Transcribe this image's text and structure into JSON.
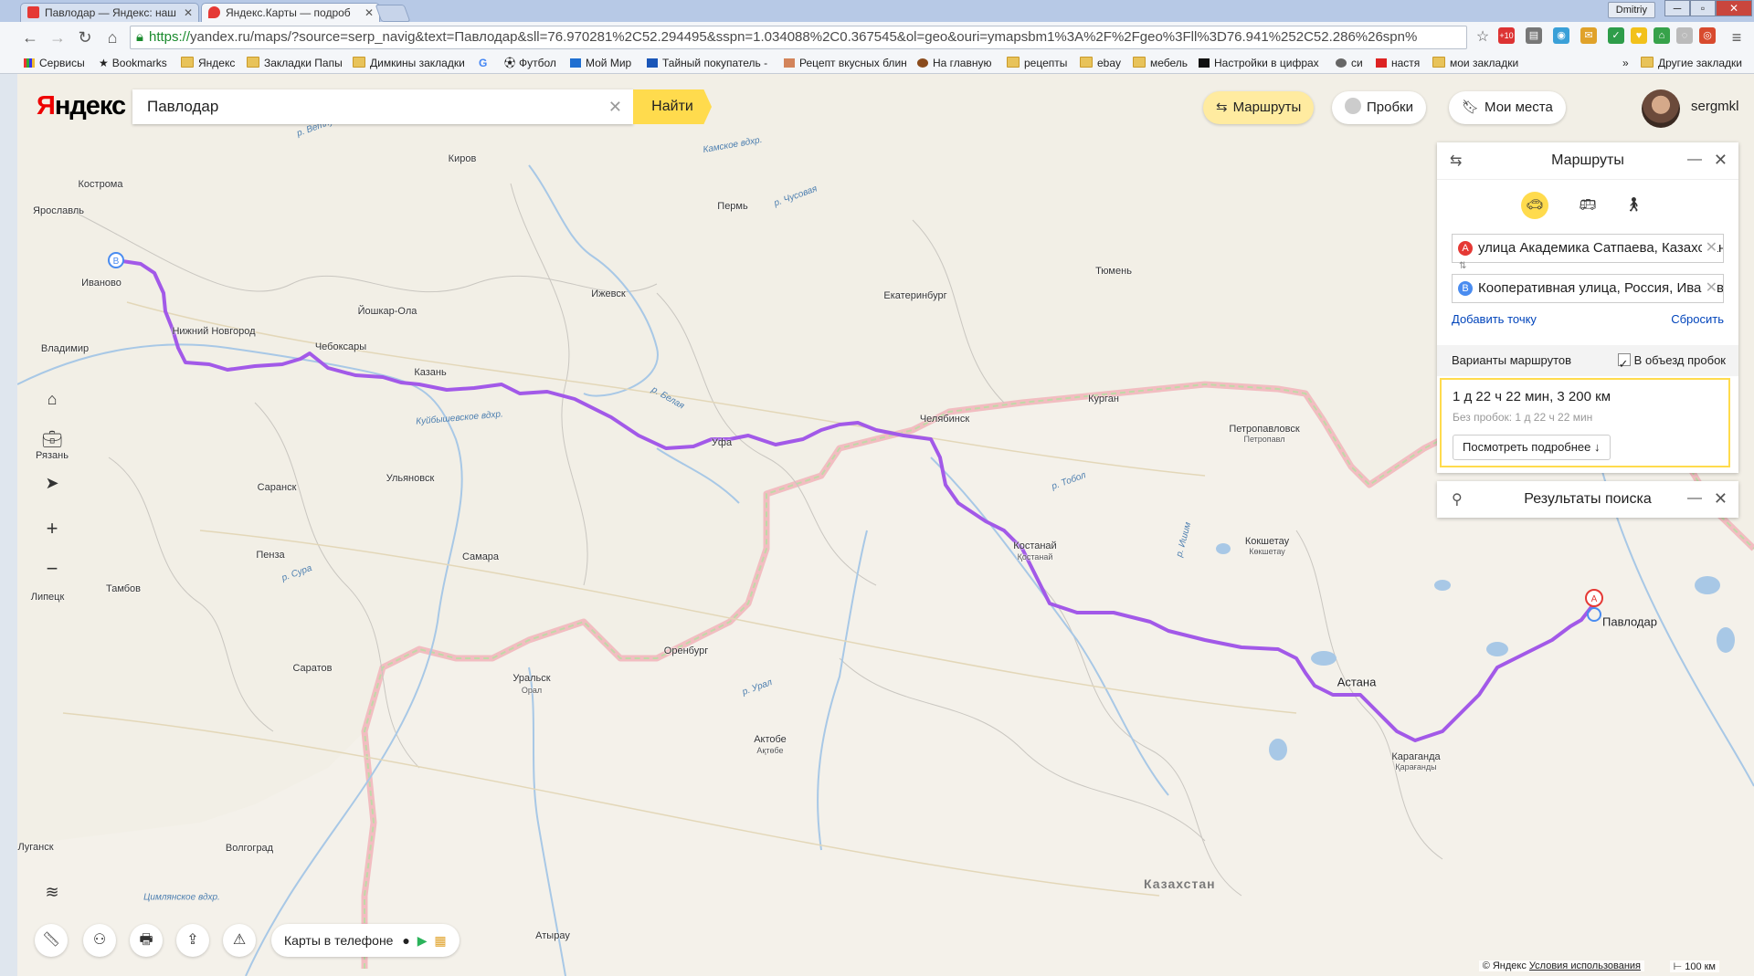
{
  "browser": {
    "tabs": [
      {
        "title": "Павлодар — Яндекс: наш",
        "active": false,
        "favicon_color": "#e53935"
      },
      {
        "title": "Яндекс.Карты — подроб",
        "active": true,
        "favicon_color": "#e53935"
      }
    ],
    "user": "Dmitriy",
    "url_proto": "https://",
    "url_rest": "yandex.ru/maps/?source=serp_navig&text=Павлодар&sll=76.970281%2C52.294495&sspn=1.034088%2C0.367545&ol=geo&ouri=ymapsbm1%3A%2F%2Fgeo%3Fll%3D76.941%252C52.286%26spn%",
    "bookmarks": [
      "Сервисы",
      "Bookmarks",
      "Яндекс",
      "Закладки Папы",
      "Димкины закладки",
      "Футбол",
      "Мой Мир",
      "Тайный покупатель -",
      "Рецепт вкусных блин",
      "На главную",
      "рецепты",
      "ebay",
      "мебель",
      "Настройки в цифрах",
      "си",
      "настя",
      "мои закладки",
      "Другие закладки"
    ],
    "ext_badge": "+10"
  },
  "header": {
    "logo_red": "Я",
    "logo_rest": "ндекс",
    "search_value": "Павлодар",
    "search_button": "Найти",
    "routes_button": "Маршруты",
    "traffic_button": "Пробки",
    "places_button": "Мои места",
    "username": "sergmkl"
  },
  "route_panel": {
    "title": "Маршруты",
    "modes": [
      "car-icon",
      "bus-icon",
      "walk-icon"
    ],
    "point_a_marker": "A",
    "point_a": "улица Академика Сатпаева, Казахстан",
    "point_b_marker": "B",
    "point_b": "Кооперативная улица, Россия, Иваново",
    "add_point": "Добавить точку",
    "reset": "Сбросить",
    "variants_label": "Варианты маршрутов",
    "avoid_traffic_label": "В объезд пробок",
    "avoid_traffic_checked": true,
    "route_summary": "1 д 22 ч 22 мин, 3 200 км",
    "route_no_traffic": "Без пробок: 1 д 22 ч 22 мин",
    "details_button": "Посмотреть подробнее ↓"
  },
  "results_panel": {
    "title": "Результаты поиска"
  },
  "bottom": {
    "apps_label": "Карты в телефоне",
    "copyright": "© Яндекс",
    "terms": "Условия использования",
    "scale": "100 км"
  },
  "map_labels": {
    "cities": [
      "Кострома",
      "Ярославль",
      "Иваново",
      "Владимир",
      "Нижний Новгород",
      "Чебоксары",
      "Йошкар-Ола",
      "Казань",
      "Киров",
      "Пермь",
      "Ижевск",
      "Екатеринбург",
      "Тюмень",
      "Челябинск",
      "Курган",
      "Уфа",
      "Рязань",
      "Саранск",
      "Ульяновск",
      "Пенза",
      "Самара",
      "Тамбов",
      "Липецк",
      "Саратов",
      "Оренбург",
      "Уральск",
      "Актобе",
      "Волгоград",
      "Луганск",
      "Петропавловск",
      "Кокшетау",
      "Костанай",
      "Астана",
      "Павлодар",
      "Караганда",
      "Атырау"
    ],
    "cities_sub": [
      "Орал",
      "Ақтөбе",
      "Петропавл",
      "Көкшетау",
      "Қостанай",
      "Қарағанды"
    ],
    "rivers": [
      "р. Ветлуга",
      "Камское вдхр.",
      "р. Чусовая",
      "р. Белая",
      "р. Тобол",
      "р. Урал",
      "р. Сура",
      "р. Ишим",
      "Куйбышевское вдхр.",
      "Цимлянское вдхр."
    ],
    "country": "Казахстан"
  },
  "colors": {
    "route": "#a259e8",
    "accent": "#ffdb4d",
    "marker_a": "#e53935",
    "marker_b": "#4a8cf0"
  }
}
